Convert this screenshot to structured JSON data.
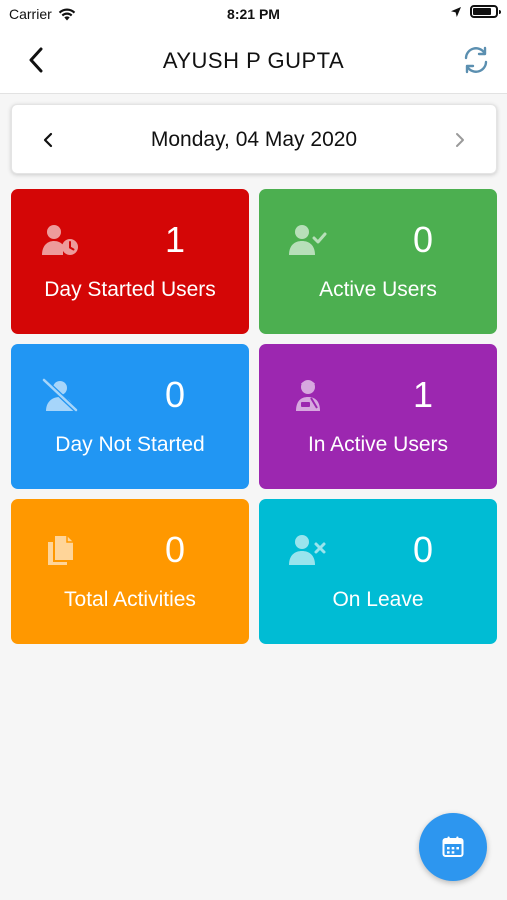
{
  "status_bar": {
    "carrier": "Carrier",
    "time": "8:21 PM"
  },
  "header": {
    "title": "AYUSH P GUPTA"
  },
  "date_selector": {
    "date": "Monday, 04 May 2020"
  },
  "tiles": [
    {
      "label": "Day Started Users",
      "count": "1",
      "color": "#d40606",
      "icon": "user-clock-icon"
    },
    {
      "label": "Active Users",
      "count": "0",
      "color": "#4caf50",
      "icon": "user-check-icon"
    },
    {
      "label": "Day Not Started",
      "count": "0",
      "color": "#2196f3",
      "icon": "user-slash-icon"
    },
    {
      "label": "In Active Users",
      "count": "1",
      "color": "#9c27b0",
      "icon": "user-injured-icon"
    },
    {
      "label": "Total Activities",
      "count": "0",
      "color": "#ff9800",
      "icon": "copy-icon"
    },
    {
      "label": "On Leave",
      "count": "0",
      "color": "#00bcd4",
      "icon": "user-times-icon"
    }
  ],
  "fab": {
    "icon": "calendar-icon",
    "color": "#2d96ef"
  }
}
